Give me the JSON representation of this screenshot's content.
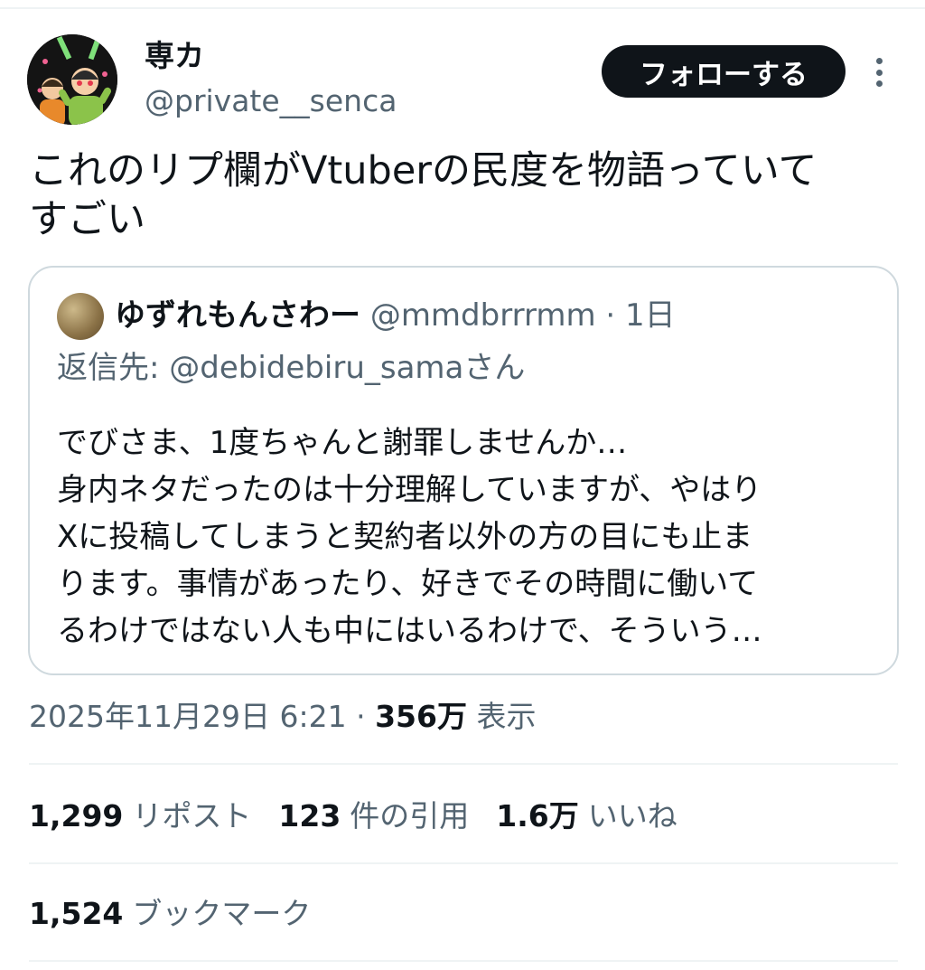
{
  "author": {
    "display_name": "専カ",
    "handle": "@private__senca"
  },
  "follow_button": {
    "label": "フォローする"
  },
  "tweet": {
    "lines": [
      "これのリプ欄がVtuberの民度を物語っていて",
      "すごい"
    ]
  },
  "quoted": {
    "display_name": "ゆずれもんさわー",
    "handle": "@mmdbrrrmm",
    "separator": "·",
    "age": "1日",
    "reply_prefix": "返信先:",
    "reply_to": "@debidebiru_samaさん",
    "body_lines": [
      "でびさま、1度ちゃんと謝罪しませんか…",
      "身内ネタだったのは十分理解していますが、やはり",
      "Xに投稿してしまうと契約者以外の方の目にも止ま",
      "ります。事情があったり、好きでその時間に働いて",
      "るわけではない人も中にはいるわけで、そういう…"
    ]
  },
  "meta": {
    "timestamp": "2025年11月29日 6:21",
    "separator": "·",
    "views_count": "356万",
    "views_label": "表示"
  },
  "stats": {
    "reposts": {
      "count": "1,299",
      "label": "リポスト"
    },
    "quotes": {
      "count": "123",
      "label": "件の引用"
    },
    "likes": {
      "count": "1.6万",
      "label": "いいね"
    },
    "bookmarks": {
      "count": "1,524",
      "label": "ブックマーク"
    }
  },
  "colors": {
    "text_primary": "#0f1419",
    "text_secondary": "#536471",
    "border": "#cfd9de",
    "button_bg": "#0f1419"
  }
}
